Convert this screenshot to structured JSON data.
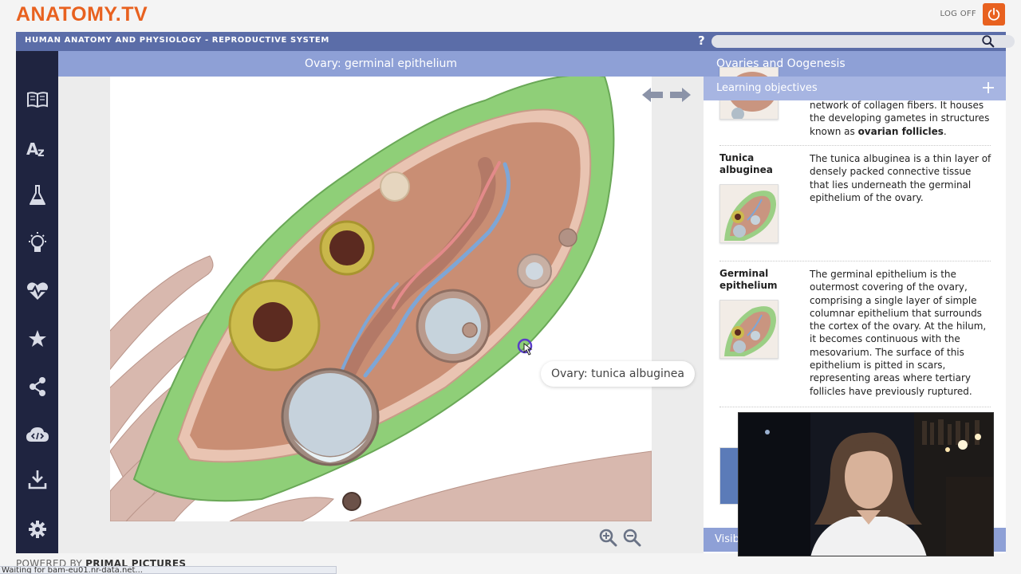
{
  "header": {
    "logo": "ANATOMY.TV",
    "logoff_label": "LOG OFF"
  },
  "titlebar": {
    "title": "HUMAN ANATOMY AND PHYSIOLOGY - REPRODUCTIVE SYSTEM",
    "help_label": "?",
    "search_value": ""
  },
  "sidebar": {
    "items": [
      {
        "icon": "book-icon"
      },
      {
        "icon": "a-z-glossary-icon"
      },
      {
        "icon": "flask-icon"
      },
      {
        "icon": "lightbulb-icon"
      },
      {
        "icon": "heartbeat-icon"
      },
      {
        "icon": "star-icon"
      },
      {
        "icon": "share-icon"
      },
      {
        "icon": "cloud-code-icon"
      },
      {
        "icon": "download-icon"
      },
      {
        "icon": "gear-icon"
      }
    ]
  },
  "viewer": {
    "title": "Ovary: germinal epithelium",
    "tooltip": "Ovary: tunica albuginea"
  },
  "panel": {
    "title": "Ovaries and Oogenesis",
    "subheader": "Learning objectives",
    "partial_entry": {
      "text_parts": [
        "network of collagen fibers. It houses the developing gametes in structures known as ",
        "ovarian follicles",
        "."
      ]
    },
    "entries": [
      {
        "term": "Tunica albuginea",
        "text": "The tunica albuginea is a thin layer of densely packed connective tissue that lies underneath the germinal epithelium of the ovary."
      },
      {
        "term": "Germinal epithelium",
        "text": "The germinal epithelium is the outermost covering of the ovary, comprising a single layer of simple columnar epithelium that surrounds the cortex of the ovary. At the hilum, it becomes continuous with the mesovarium. The surface of this epithelium is pitted in scars, representing areas where tertiary follicles have previously ruptured."
      }
    ],
    "visible_button": "Visible"
  },
  "footer": {
    "powered_prefix": "POWERED BY",
    "powered_brand": "PRIMAL PICTURES",
    "status": "Waiting for bam-eu01.nr-data.net..."
  },
  "colors": {
    "brand_orange": "#e8611f",
    "titlebar_blue": "#5b6da8",
    "panel_blue": "#8ea0d6",
    "sidebar_navy": "#1f2440"
  }
}
